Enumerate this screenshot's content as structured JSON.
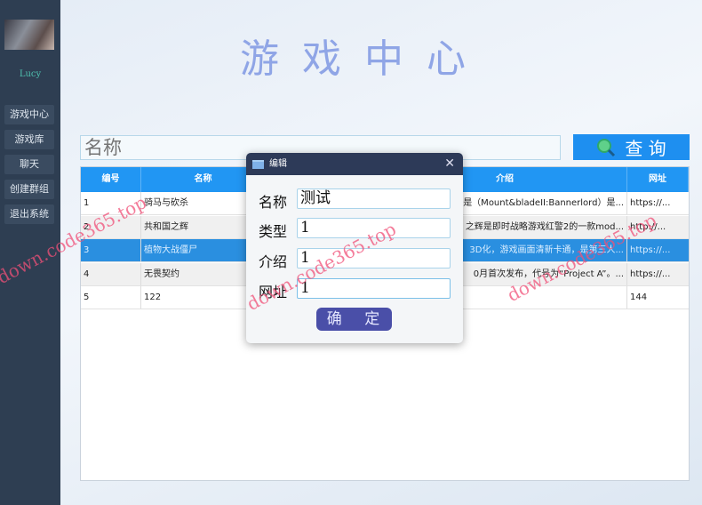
{
  "sidebar": {
    "username": "Lucy",
    "items": [
      {
        "label": "游戏中心"
      },
      {
        "label": "游戏库"
      },
      {
        "label": "聊天"
      },
      {
        "label": "创建群组"
      },
      {
        "label": "退出系统"
      }
    ]
  },
  "header": {
    "title": "游戏中心"
  },
  "search": {
    "placeholder": "名称",
    "button_label": "查 询"
  },
  "table": {
    "columns": [
      "编号",
      "名称",
      "",
      "介绍",
      "网址"
    ],
    "rows": [
      [
        "1",
        "骑马与砍杀",
        "",
        "是（Mount&bladeII:Bannerlord）是...",
        "https://..."
      ],
      [
        "2",
        "共和国之辉",
        "",
        "之辉是即时战略游戏红警2的一款mod...",
        "http://..."
      ],
      [
        "3",
        "植物大战僵尸",
        "",
        "3D化，游戏画面清新卡通，是第三人...",
        "https://..."
      ],
      [
        "4",
        "无畏契约",
        "",
        "0月首次发布，代号为“Project A”。...",
        "https://..."
      ],
      [
        "5",
        "122",
        "",
        "",
        "144"
      ]
    ]
  },
  "dialog": {
    "title": "编辑",
    "fields": [
      {
        "label": "名称",
        "value": "测试"
      },
      {
        "label": "类型",
        "value": "1"
      },
      {
        "label": "介绍",
        "value": "1"
      },
      {
        "label": "网址",
        "value": "1"
      }
    ],
    "confirm_label": "确 定"
  },
  "watermark": "down.code365.top"
}
